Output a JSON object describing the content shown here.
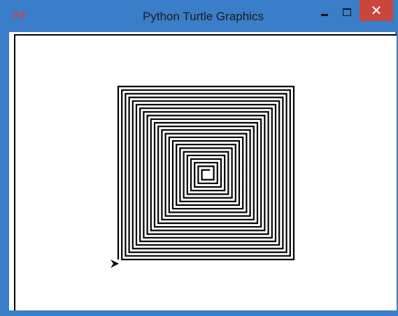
{
  "window": {
    "title": "Python Turtle Graphics",
    "app_icon_label": "7#",
    "close_glyph": "✕"
  },
  "drawing": {
    "shape": "square spiral",
    "pen_color": "#000000",
    "background": "#ffffff",
    "turtle_shape": "classic arrow",
    "turtle_heading": "east"
  },
  "colors": {
    "titlebar": "#3a7dc8",
    "close_button": "#c9463d"
  }
}
